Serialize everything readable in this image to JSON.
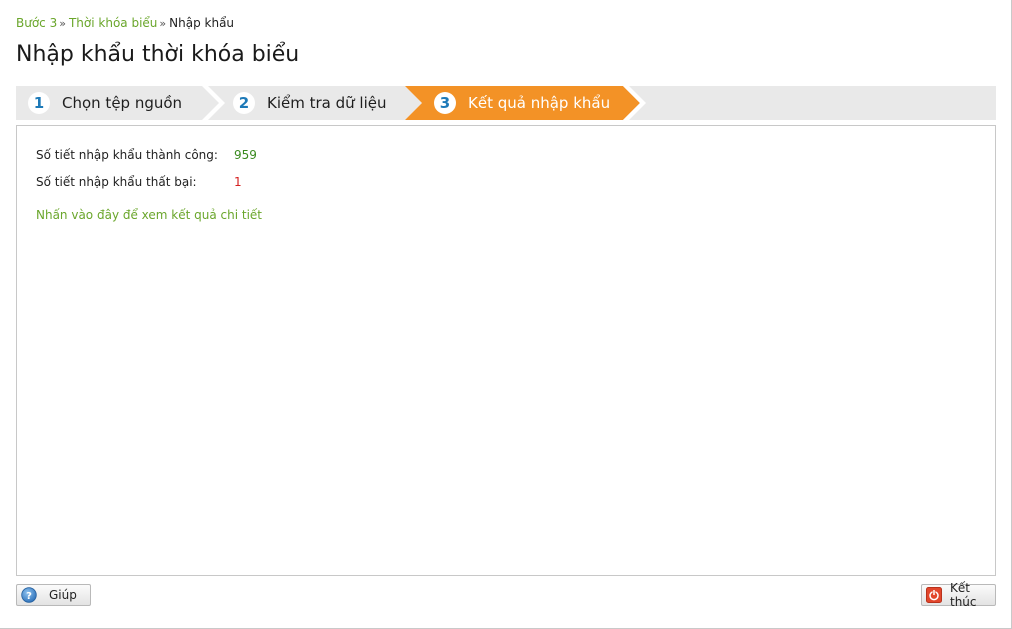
{
  "breadcrumb": {
    "items": [
      "Bước 3",
      "Thời khóa biểu"
    ],
    "separator": "»",
    "current": "Nhập khẩu"
  },
  "page_title": "Nhập khẩu thời khóa biểu",
  "wizard": {
    "steps": [
      {
        "number": "1",
        "label": "Chọn tệp nguồn",
        "active": false
      },
      {
        "number": "2",
        "label": "Kiểm tra dữ liệu",
        "active": false
      },
      {
        "number": "3",
        "label": "Kết quả nhập khẩu",
        "active": true
      }
    ],
    "active_color": "#f39226",
    "inactive_color": "#e9e9e9"
  },
  "results": {
    "success_label": "Số tiết nhập khẩu thành công:",
    "success_value": "959",
    "fail_label": "Số tiết nhập khẩu thất bại:",
    "fail_value": "1",
    "detail_link": "Nhấn vào đây để xem kết quả chi tiết"
  },
  "footer": {
    "help_label": "Giúp",
    "help_icon": "help-icon",
    "finish_label": "Kết thúc",
    "finish_icon": "power-icon"
  }
}
